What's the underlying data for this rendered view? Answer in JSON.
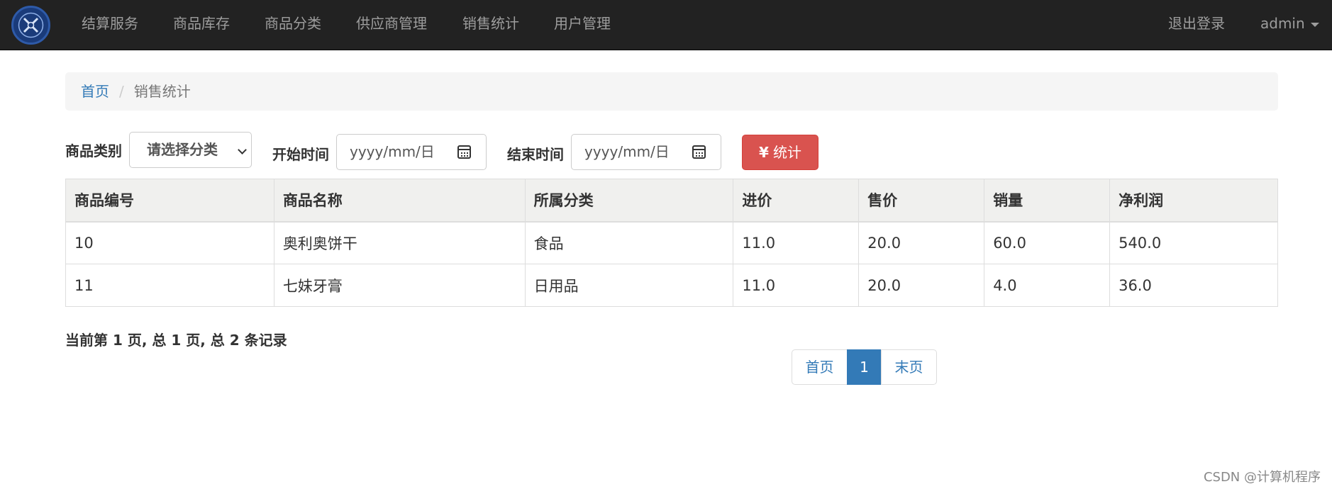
{
  "navbar": {
    "items": [
      {
        "label": "结算服务"
      },
      {
        "label": "商品库存"
      },
      {
        "label": "商品分类"
      },
      {
        "label": "供应商管理"
      },
      {
        "label": "销售统计"
      },
      {
        "label": "用户管理"
      }
    ],
    "logout_label": "退出登录",
    "user_label": "admin"
  },
  "breadcrumb": {
    "home": "首页",
    "separator": "/",
    "current": "销售统计"
  },
  "filter": {
    "category_label": "商品类别",
    "category_value": "请选择分类",
    "start_label": "开始时间",
    "start_placeholder": "yyyy/mm/日",
    "end_label": "结束时间",
    "end_placeholder": "yyyy/mm/日",
    "submit_icon": "¥",
    "submit_label": "统计"
  },
  "table": {
    "headers": [
      "商品编号",
      "商品名称",
      "所属分类",
      "进价",
      "售价",
      "销量",
      "净利润"
    ],
    "rows": [
      [
        "10",
        "奥利奥饼干",
        "食品",
        "11.0",
        "20.0",
        "60.0",
        "540.0"
      ],
      [
        "11",
        "七妹牙膏",
        "日用品",
        "11.0",
        "20.0",
        "4.0",
        "36.0"
      ]
    ]
  },
  "page_info": "当前第 1 页, 总 1 页, 总 2 条记录",
  "pagination": {
    "first": "首页",
    "current": "1",
    "last": "末页"
  },
  "watermark": "CSDN @计算机程序",
  "colors": {
    "navbar_bg": "#222222",
    "link": "#337ab7",
    "danger": "#d9534f",
    "active_page": "#337ab7"
  }
}
